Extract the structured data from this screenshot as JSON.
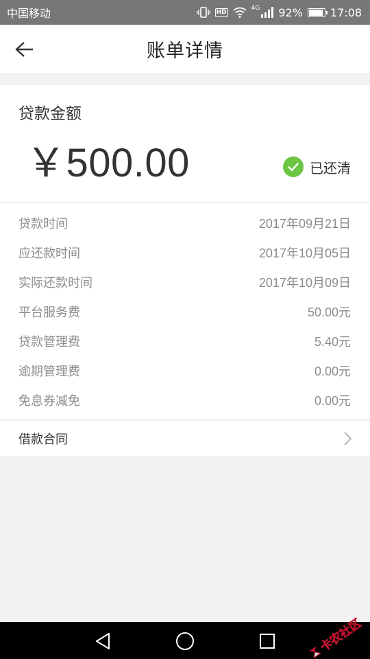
{
  "status_bar": {
    "carrier": "中国移动",
    "hd": "HD",
    "network": "4G",
    "battery_percent": "92%",
    "time": "17:08"
  },
  "header": {
    "title": "账单详情"
  },
  "loan": {
    "label": "贷款金额",
    "amount": "￥500.00",
    "status": "已还清"
  },
  "details": [
    {
      "label": "贷款时间",
      "value": "2017年09月21日"
    },
    {
      "label": "应还款时间",
      "value": "2017年10月05日"
    },
    {
      "label": "实际还款时间",
      "value": "2017年10月09日"
    },
    {
      "label": "平台服务费",
      "value": "50.00元"
    },
    {
      "label": "贷款管理费",
      "value": "5.40元"
    },
    {
      "label": "逾期管理费",
      "value": "0.00元"
    },
    {
      "label": "免息券减免",
      "value": "0.00元"
    }
  ],
  "contract": {
    "label": "借款合同"
  },
  "watermark": {
    "text": "卡农社区"
  },
  "colors": {
    "status_bar_bg": "#777777",
    "success_green": "#6cc644",
    "nav_bar_bg": "#000000",
    "watermark_red": "#c8102e"
  },
  "icons": {
    "back": "arrow-left-icon",
    "status_check": "check-circle-icon",
    "contract_chevron": "chevron-right-icon",
    "nav_back": "triangle-back-icon",
    "nav_home": "circle-home-icon",
    "nav_recent": "square-recent-icon"
  }
}
